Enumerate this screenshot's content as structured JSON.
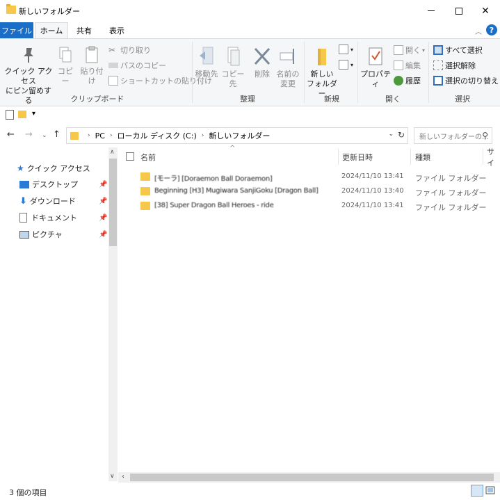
{
  "window": {
    "title": "新しいフォルダー"
  },
  "tabs": [
    {
      "label": "ファイル"
    },
    {
      "label": "ホーム"
    },
    {
      "label": "共有"
    },
    {
      "label": "表示"
    }
  ],
  "ribbon": {
    "clipboard": {
      "pin_label_1": "クイック アクセス",
      "pin_label_2": "にピン留めする",
      "copy": "コピー",
      "paste": "貼り付け",
      "cut": "切り取り",
      "copy_path": "パスのコピー",
      "paste_shortcut": "ショートカットの貼り付け",
      "group": "クリップボード"
    },
    "organize": {
      "move_to": "移動先",
      "copy_to": "コピー先",
      "delete": "削除",
      "rename_1": "名前の",
      "rename_2": "変更",
      "group": "整理"
    },
    "new": {
      "new_folder_1": "新しい",
      "new_folder_2": "フォルダー",
      "group": "新規"
    },
    "open": {
      "properties": "プロパティ",
      "open": "開く",
      "edit": "編集",
      "history": "履歴",
      "group": "開く"
    },
    "select": {
      "select_all": "すべて選択",
      "select_none": "選択解除",
      "invert": "選択の切り替え",
      "group": "選択"
    }
  },
  "address": {
    "parts": [
      "PC",
      "ローカル ディスク (C:)",
      "新しいフォルダー"
    ],
    "search_placeholder": "新しいフォルダーの..."
  },
  "navpane": {
    "quick_access": "クイック アクセス",
    "items": [
      {
        "label": "デスクトップ"
      },
      {
        "label": "ダウンロード"
      },
      {
        "label": "ドキュメント"
      },
      {
        "label": "ピクチャ"
      }
    ]
  },
  "columns": {
    "name": "名前",
    "date": "更新日時",
    "type": "種類",
    "size": "サイ"
  },
  "files": [
    {
      "name": "[モーラ] [Doraemon Ball Doraemon]",
      "date": "2024/11/10 13:41",
      "type": "ファイル フォルダー"
    },
    {
      "name": "Beginning [H3] Mugiwara SanjiGoku [Dragon Ball]",
      "date": "2024/11/10 13:40",
      "type": "ファイル フォルダー"
    },
    {
      "name": "[38] Super Dragon Ball Heroes - ride",
      "date": "2024/11/10 13:41",
      "type": "ファイル フォルダー"
    }
  ],
  "status": {
    "count": "3 個の項目"
  },
  "colors": {
    "accent": "#1a6ec7",
    "folder": "#f5c84c"
  }
}
